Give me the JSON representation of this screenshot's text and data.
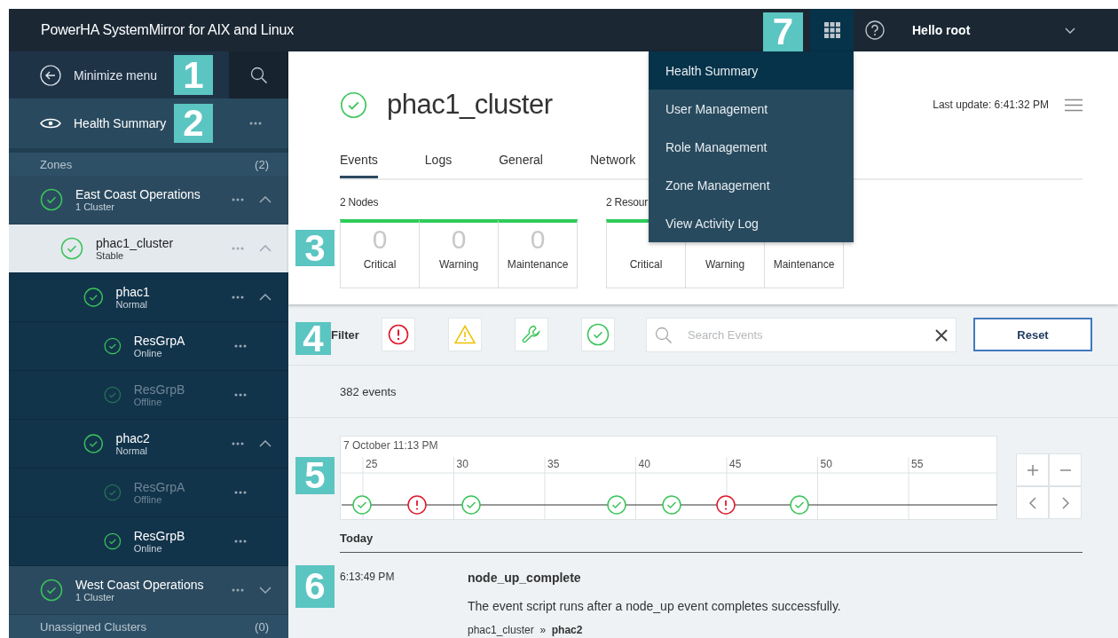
{
  "header": {
    "title": "PowerHA SystemMirror for AIX and Linux",
    "user": "Hello root"
  },
  "apps_menu": {
    "open": true,
    "items": [
      {
        "label": "Health Summary",
        "selected": true
      },
      {
        "label": "User Management",
        "selected": false
      },
      {
        "label": "Role Management",
        "selected": false
      },
      {
        "label": "Zone Management",
        "selected": false
      },
      {
        "label": "View Activity Log",
        "selected": false
      }
    ]
  },
  "sidebar": {
    "minimize_label": "Minimize menu",
    "nav_label": "Health Summary",
    "zones": {
      "label": "Zones",
      "count": "(2)"
    },
    "tree": [
      {
        "name": "East Coast Operations",
        "status": "1 Cluster",
        "dimmed": false,
        "selected": false,
        "expanded": true,
        "children": [
          {
            "name": "phac1_cluster",
            "status": "Stable",
            "dimmed": false,
            "selected": true,
            "expanded": true,
            "children": [
              {
                "name": "phac1",
                "status": "Normal",
                "dimmed": false,
                "selected": false,
                "expanded": true,
                "children": [
                  {
                    "name": "ResGrpA",
                    "status": "Online",
                    "dimmed": false,
                    "selected": false
                  },
                  {
                    "name": "ResGrpB",
                    "status": "Offline",
                    "dimmed": true,
                    "selected": false
                  }
                ]
              },
              {
                "name": "phac2",
                "status": "Normal",
                "dimmed": false,
                "selected": false,
                "expanded": true,
                "children": [
                  {
                    "name": "ResGrpA",
                    "status": "Offline",
                    "dimmed": true,
                    "selected": false
                  },
                  {
                    "name": "ResGrpB",
                    "status": "Online",
                    "dimmed": false,
                    "selected": false
                  }
                ]
              }
            ]
          }
        ]
      },
      {
        "name": "West Coast Operations",
        "status": "1 Cluster",
        "dimmed": false,
        "selected": false,
        "expanded": false
      }
    ],
    "unassigned": {
      "label": "Unassigned Clusters",
      "count": "(0)"
    }
  },
  "main": {
    "title": "phac1_cluster",
    "last_update": "Last update: 6:41:32 PM",
    "tabs": [
      {
        "label": "Events",
        "selected": true
      },
      {
        "label": "Logs",
        "selected": false
      },
      {
        "label": "General",
        "selected": false
      },
      {
        "label": "Network",
        "selected": false
      }
    ],
    "groups": [
      {
        "label": "2 Nodes",
        "tiles": [
          {
            "count": "0",
            "label": "Critical"
          },
          {
            "count": "0",
            "label": "Warning"
          },
          {
            "count": "0",
            "label": "Maintenance"
          }
        ]
      },
      {
        "label": "2 Resour",
        "tiles": [
          {
            "label": "Critical"
          },
          {
            "label": "Warning"
          },
          {
            "label": "Maintenance"
          }
        ]
      }
    ]
  },
  "filter": {
    "label": "Filter",
    "buttons": [
      {
        "kind": "critical"
      },
      {
        "kind": "warning"
      },
      {
        "kind": "maintenance"
      },
      {
        "kind": "normal"
      }
    ],
    "search": {
      "placeholder": "Search Events"
    },
    "reset": "Reset"
  },
  "event_count": "382 events",
  "timeline": {
    "date": "7 October 11:13 PM",
    "ticks": [
      "25",
      "30",
      "35",
      "40",
      "45",
      "50",
      "55"
    ],
    "markers": [
      {
        "kind": "normal"
      },
      {
        "kind": "critical"
      },
      {
        "kind": "normal"
      },
      {
        "kind": "normal"
      },
      {
        "kind": "normal"
      },
      {
        "kind": "critical"
      },
      {
        "kind": "normal"
      }
    ]
  },
  "day": "Today",
  "events": [
    {
      "time": "6:13:49 PM",
      "name": "node_up_complete",
      "description": "The event script runs after a node_up event completes successfully.",
      "path": "phac1_cluster  »  **phac2**"
    }
  ],
  "callouts": [
    "1",
    "2",
    "3",
    "4",
    "5",
    "6",
    "7"
  ]
}
